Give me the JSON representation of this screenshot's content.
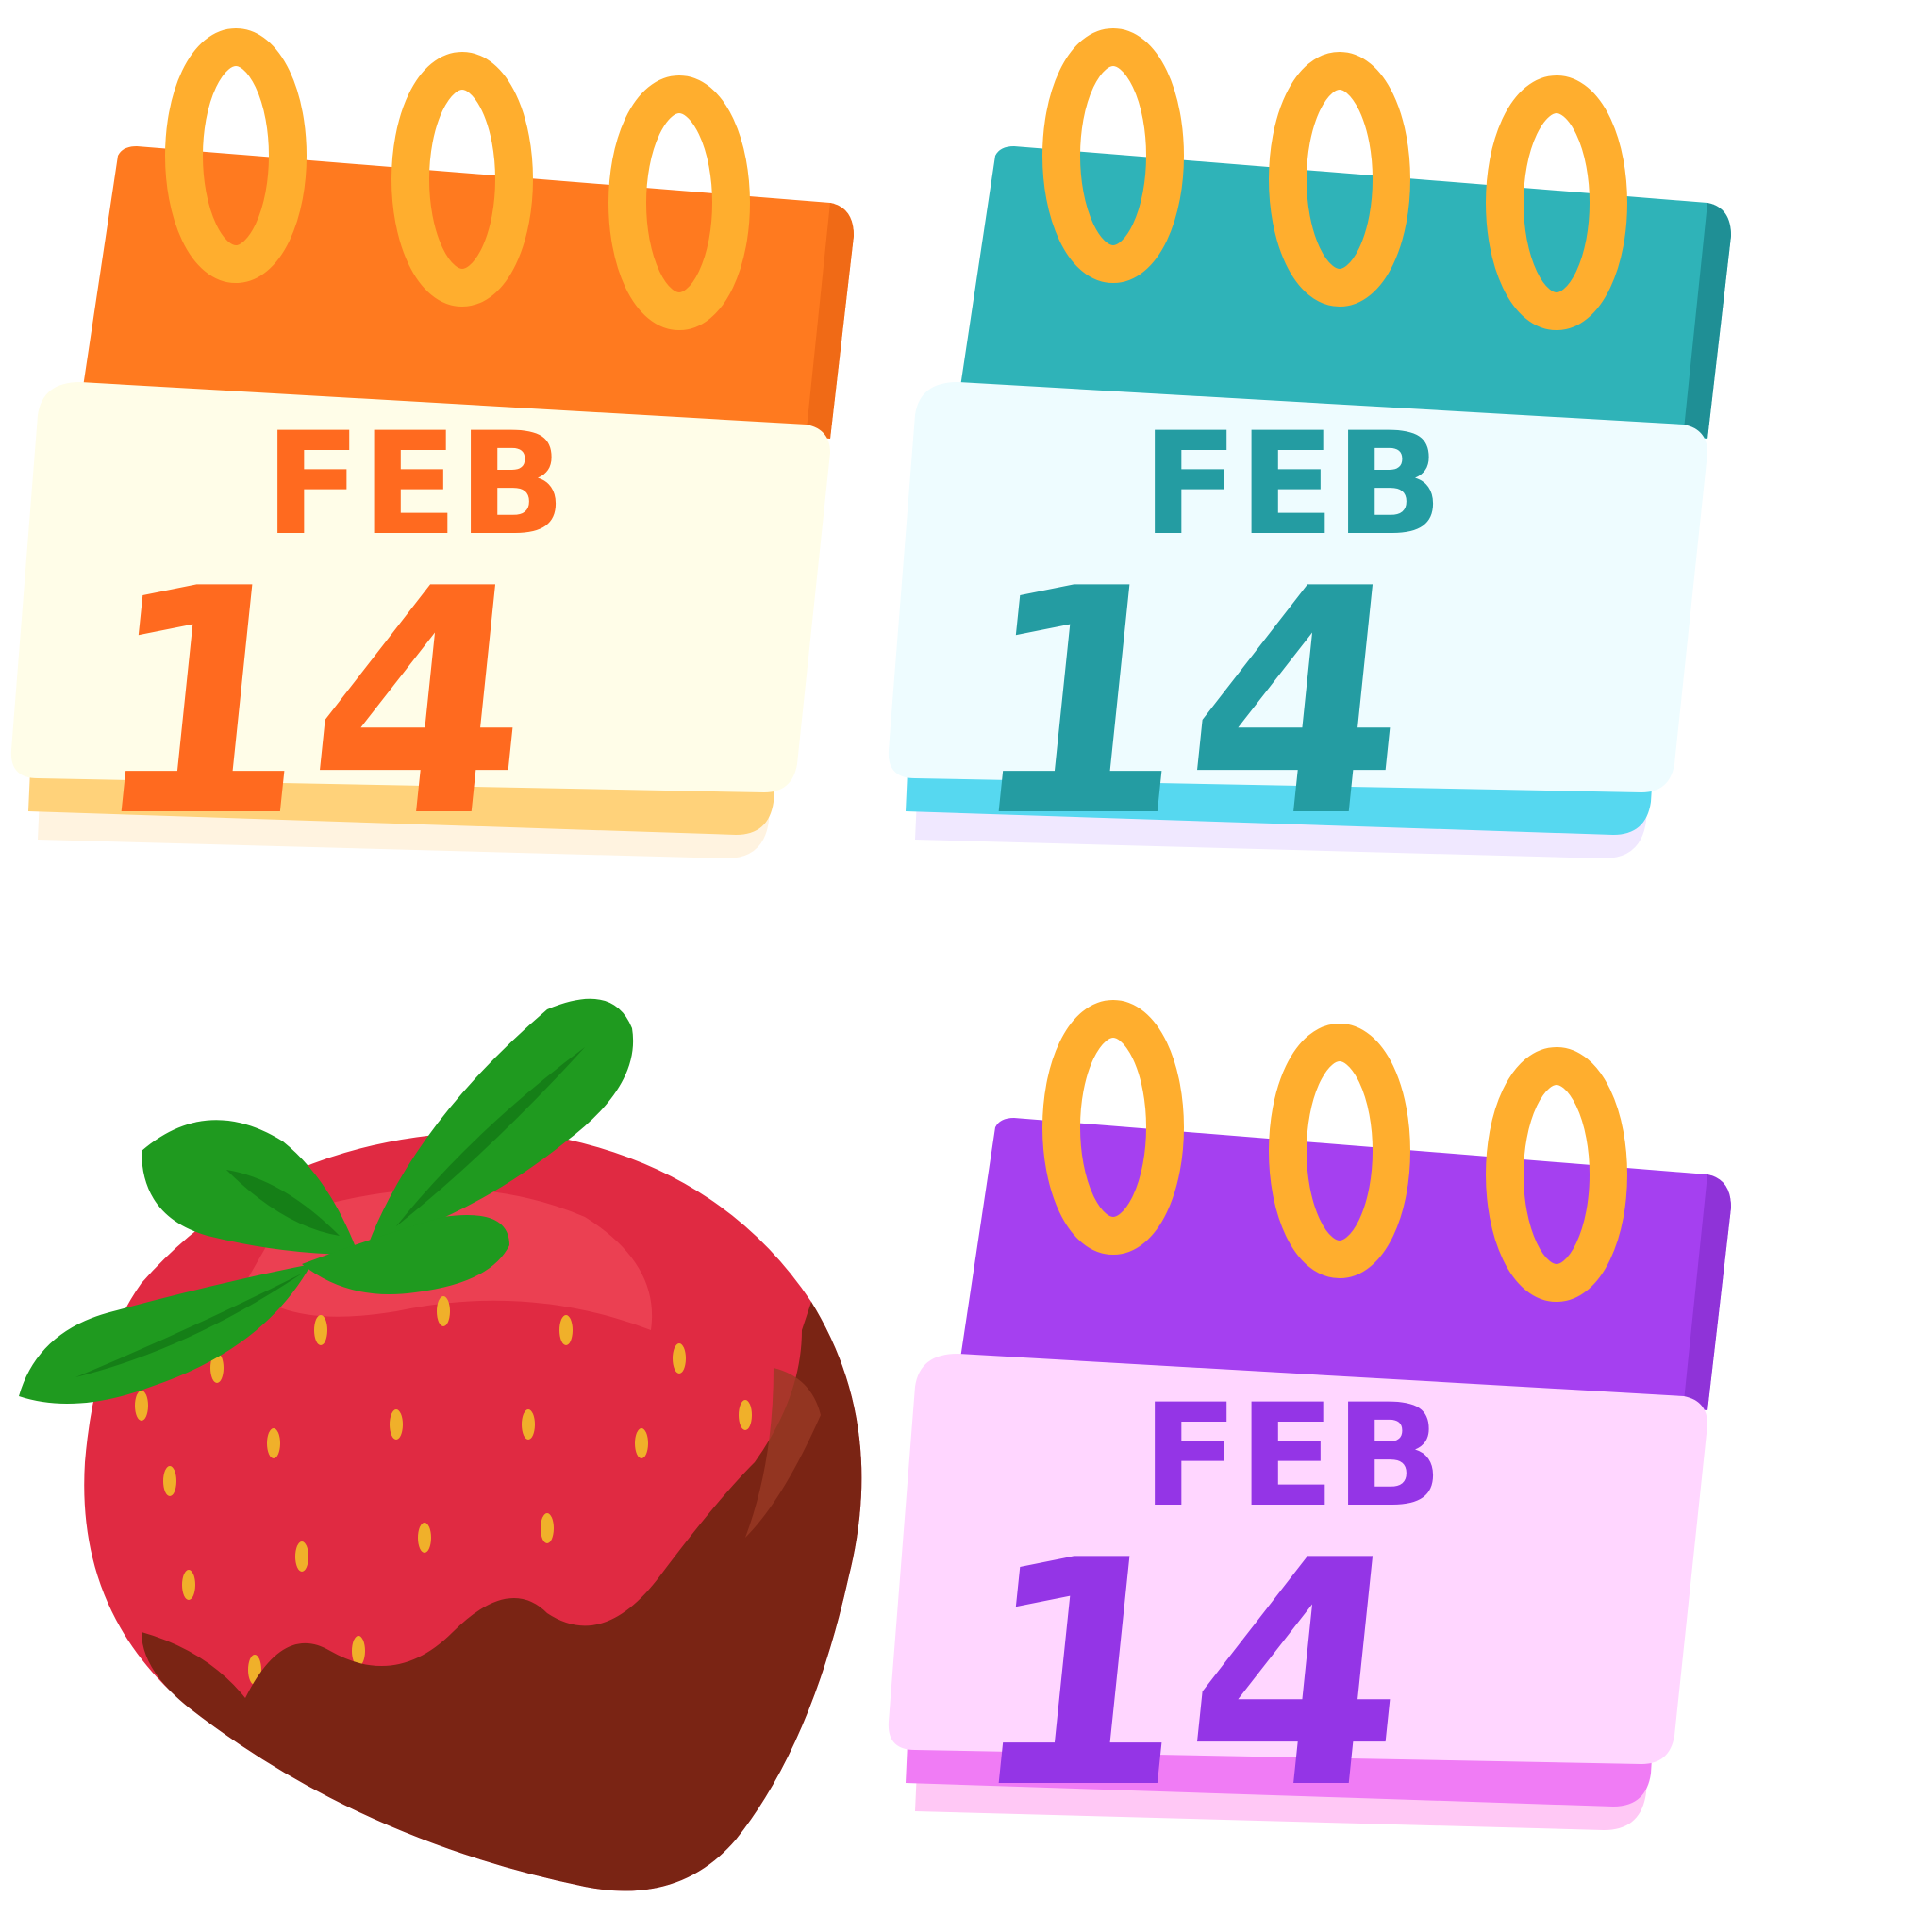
{
  "calendars": [
    {
      "month": "FEB",
      "day": "14",
      "colors": {
        "header": "#ff7a1f",
        "header_dark": "#f05a14",
        "header_side": "#f06a16",
        "page": "#fffde8",
        "text": "#ff6a1f",
        "edge_tint": "#ffd27a",
        "ring": "#ffae2e",
        "ring_dark": "#e8901c"
      }
    },
    {
      "month": "FEB",
      "day": "14",
      "colors": {
        "header": "#2fb3b8",
        "header_dark": "#1e9aa2",
        "header_side": "#1f8f95",
        "page": "#eefcff",
        "text": "#249ca2",
        "edge_tint": "#56d8f0",
        "ring": "#ffae2e",
        "ring_dark": "#e8901c"
      }
    },
    {
      "month": "FEB",
      "day": "14",
      "colors": {
        "header": "#a540f0",
        "header_dark": "#8a2ee0",
        "header_side": "#8f33d8",
        "page": "#ffd6ff",
        "text": "#9435e6",
        "edge_tint": "#f07cf5",
        "ring": "#ffae2e",
        "ring_dark": "#e8901c"
      }
    }
  ],
  "strawberry": {
    "icon": "chocolate-strawberry-icon",
    "colors": {
      "berry": "#e02a42",
      "berry_light": "#f04a5a",
      "seed": "#f0b02a",
      "chocolate": "#7a2414",
      "chocolate_light": "#9a3a24",
      "leaf": "#1f9a1f",
      "leaf_dark": "#0f6e12"
    }
  }
}
